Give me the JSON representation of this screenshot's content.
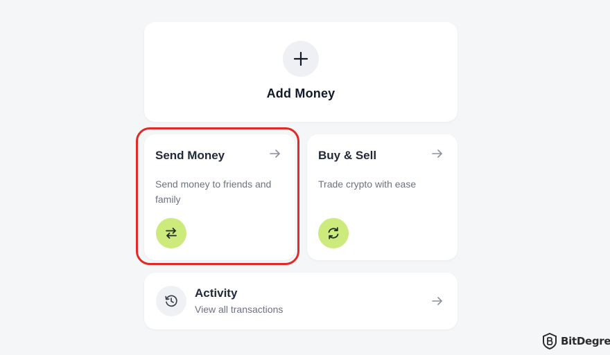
{
  "add_money": {
    "label": "Add Money",
    "icon": "plus-icon"
  },
  "send_money": {
    "title": "Send Money",
    "description_line1": "Send money to friends and",
    "description_line2": "family",
    "icon": "swap-arrows-icon",
    "arrow_icon": "arrow-right-icon",
    "highlighted": true
  },
  "buy_sell": {
    "title": "Buy & Sell",
    "description": "Trade crypto with ease",
    "icon": "refresh-icon",
    "arrow_icon": "arrow-right-icon"
  },
  "activity": {
    "title": "Activity",
    "subtitle": "View all transactions",
    "icon": "history-icon",
    "arrow_icon": "arrow-right-icon"
  },
  "watermark": {
    "text": "BitDegree",
    "icon": "bitdegree-logo-icon"
  },
  "colors": {
    "background": "#f5f6f8",
    "card": "#ffffff",
    "accent_green": "#cdea7d",
    "highlight_red": "#e02a24",
    "text_primary": "#1f2937",
    "text_secondary": "#6b7280"
  }
}
